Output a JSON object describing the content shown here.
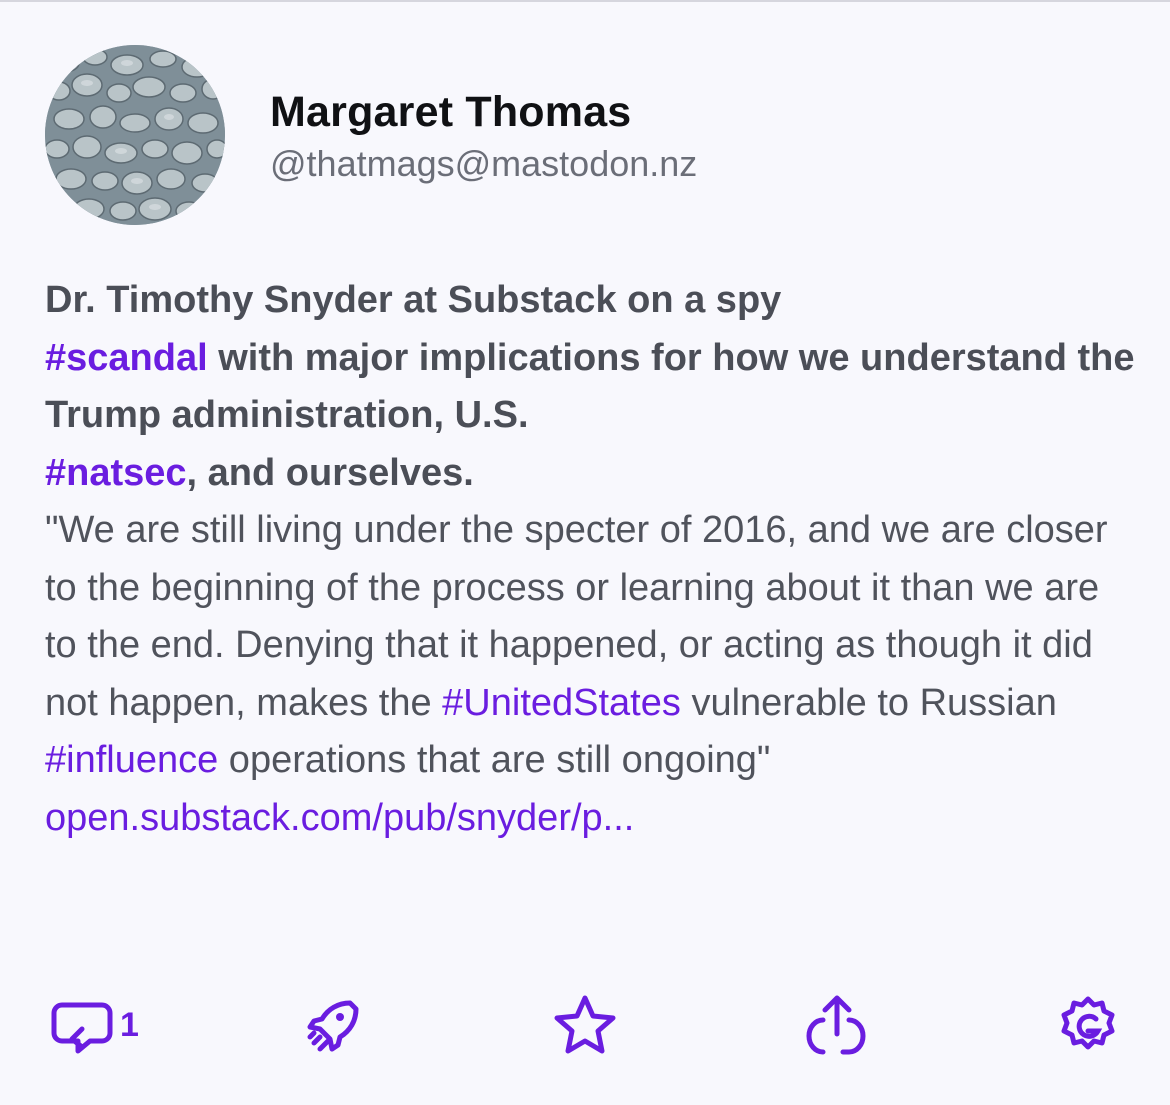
{
  "post": {
    "author": {
      "display_name": "Margaret Thomas",
      "handle": "@thatmags@mastodon.nz"
    },
    "content": {
      "bold_text": "Dr. Timothy Snyder at Substack on a spy",
      "tag_scandal": "#scandal",
      "bold_text_2": " with major implications for how we understand the Trump administration, U.S.",
      "tag_natsec": "#natsec",
      "bold_text_3": ", and ourselves.",
      "quote_1": "\"We are still living under the specter of 2016, and we are closer to the beginning of the process or learning about it than we are to the end.  Denying that it happened, or acting as though it did not happen, makes the ",
      "tag_united_states": "#UnitedStates",
      "quote_2": " vulnerable to Russian ",
      "tag_influence": "#influence",
      "quote_3": " operations that are still ongoing\"",
      "link_text": "open.substack.com/pub/snyder/p..."
    },
    "actions": {
      "reply_count": "1",
      "reply_icon": "reply-icon",
      "boost_icon": "rocket-icon",
      "favourite_icon": "star-icon",
      "share_icon": "share-icon",
      "more_icon": "gear-icon"
    },
    "colors": {
      "accent": "#6a1de0",
      "background": "#f8f8fd",
      "text": "#50535c",
      "name": "#101114"
    }
  }
}
